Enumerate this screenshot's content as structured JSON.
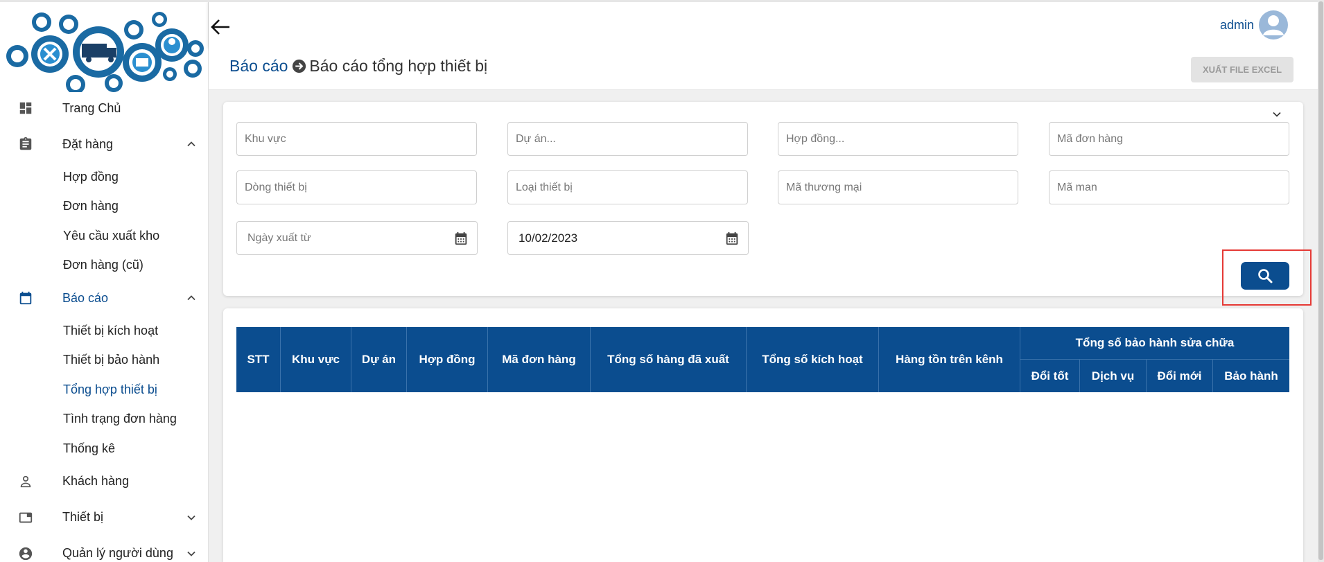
{
  "sidebar": {
    "items": [
      {
        "label": "Trang Chủ"
      },
      {
        "label": "Đặt hàng",
        "sub": [
          "Hợp đồng",
          "Đơn hàng",
          "Yêu cầu xuất kho",
          "Đơn hàng (cũ)"
        ]
      },
      {
        "label": "Báo cáo",
        "sub": [
          "Thiết bị kích hoạt",
          "Thiết bị bảo hành",
          "Tổng hợp thiết bị",
          "Tình trạng đơn hàng",
          "Thống kê"
        ]
      },
      {
        "label": "Khách hàng"
      },
      {
        "label": "Thiết bị"
      },
      {
        "label": "Quản lý người dùng"
      }
    ]
  },
  "header": {
    "user": "admin"
  },
  "breadcrumb": {
    "parent": "Báo cáo",
    "current": "Báo cáo tổng hợp thiết bị"
  },
  "actions": {
    "export_label": "XUẤT FILE EXCEL"
  },
  "filters": {
    "khu_vuc": "Khu vực",
    "du_an": "Dự án...",
    "hop_dong": "Hợp đồng...",
    "ma_don_hang": "Mã đơn hàng",
    "dong_thiet_bi": "Dòng thiết bị",
    "loai_thiet_bi": "Loại thiết bị",
    "ma_thuong_mai": "Mã thương mại",
    "ma_man": "Mã man",
    "ngay_xuat_tu": "Ngày xuất từ",
    "ngay_xuat_den_value": "10/02/2023"
  },
  "table": {
    "columns": [
      "STT",
      "Khu vực",
      "Dự án",
      "Hợp đồng",
      "Mã đơn hàng",
      "Tổng số hàng đã xuất",
      "Tổng số kích hoạt",
      "Hàng tồn trên kênh"
    ],
    "group_header": "Tổng số bảo hành sửa chữa",
    "group_columns": [
      "Đổi tốt",
      "Dịch vụ",
      "Đổi mới",
      "Bảo hành"
    ],
    "rows": []
  },
  "colors": {
    "primary": "#0b4d8f",
    "highlight": "#e53935",
    "disabled_bg": "#e3e3e3"
  },
  "icons": [
    "dashboard-icon",
    "clipboard-icon",
    "calendar-icon",
    "person-icon",
    "window-icon",
    "account-circle-icon",
    "back-arrow-icon",
    "arrow-circle-right-icon",
    "search-icon",
    "chevron-down-icon",
    "chevron-up-icon"
  ]
}
